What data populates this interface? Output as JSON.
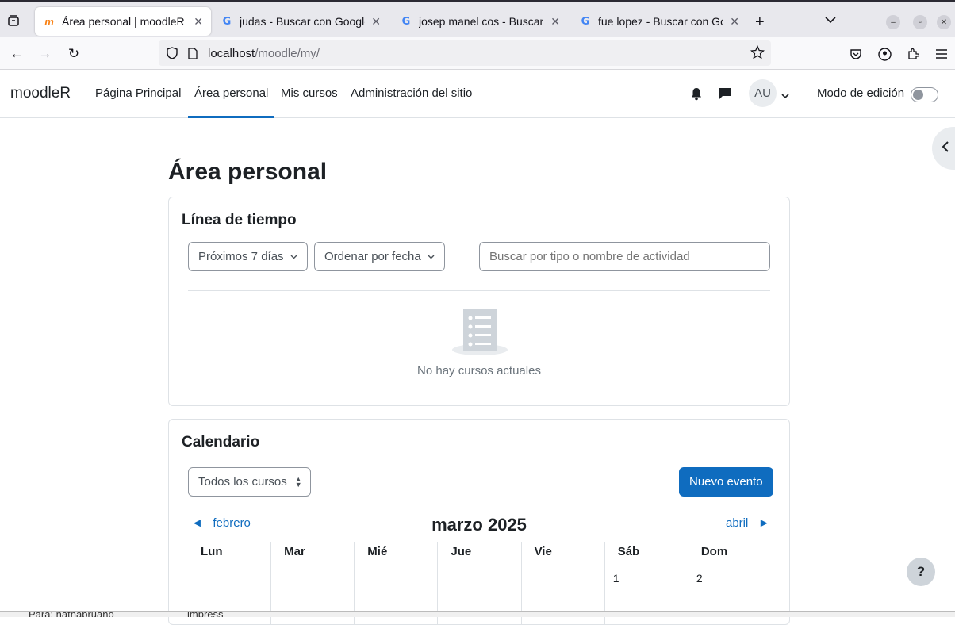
{
  "browser": {
    "tabs": [
      {
        "title": "Área personal | moodleR",
        "icon": "moodle-icon",
        "active": true
      },
      {
        "title": "judas - Buscar con Google",
        "icon": "google-icon",
        "active": false
      },
      {
        "title": "josep manel cos - Buscar c",
        "icon": "google-icon",
        "active": false
      },
      {
        "title": "fue lopez - Buscar con Go",
        "icon": "google-icon",
        "active": false
      }
    ],
    "url_host": "localhost",
    "url_path": "/moodle/my/"
  },
  "header": {
    "brand": "moodleR",
    "nav": [
      {
        "label": "Página Principal",
        "active": false
      },
      {
        "label": "Área personal",
        "active": true
      },
      {
        "label": "Mis cursos",
        "active": false
      },
      {
        "label": "Administración del sitio",
        "active": false
      }
    ],
    "avatar_initials": "AU",
    "edit_mode_label": "Modo de edición",
    "edit_mode_on": false
  },
  "page": {
    "title": "Área personal"
  },
  "timeline": {
    "heading": "Línea de tiempo",
    "filter_days": "Próximos 7 días",
    "sort": "Ordenar por fecha",
    "search_placeholder": "Buscar por tipo o nombre de actividad",
    "empty_message": "No hay cursos actuales"
  },
  "calendar": {
    "heading": "Calendario",
    "course_filter": "Todos los cursos",
    "new_event": "Nuevo evento",
    "prev_month": "febrero",
    "next_month": "abril",
    "month_title": "marzo 2025",
    "weekdays": [
      "Lun",
      "Mar",
      "Mié",
      "Jue",
      "Vie",
      "Sáb",
      "Dom"
    ],
    "first_week": [
      "",
      "",
      "",
      "",
      "",
      "1",
      "2"
    ]
  },
  "help_label": "?",
  "bottom_text": [
    "Para: natnabruano",
    "impress"
  ],
  "colors": {
    "primary": "#0f6cbf",
    "text": "#1d2125"
  }
}
